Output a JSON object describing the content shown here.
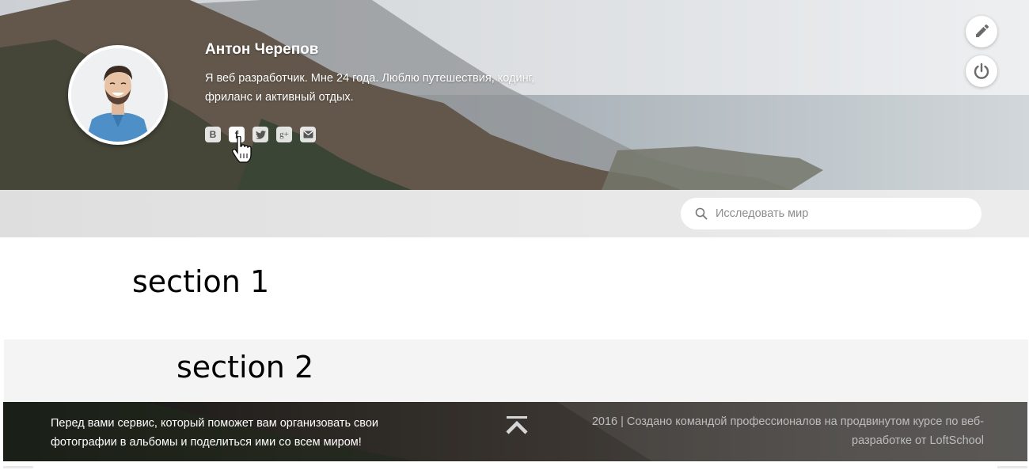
{
  "profile": {
    "name": "Антон Черепов",
    "description": "Я веб разработчик. Мне 24 года. Люблю путешествия, кодинг, фриланс и активный отдых."
  },
  "socials": [
    {
      "icon": "vk-icon",
      "glyph": "B"
    },
    {
      "icon": "facebook-icon",
      "glyph": "f"
    },
    {
      "icon": "twitter-icon"
    },
    {
      "icon": "google-plus-icon",
      "glyph": "g+"
    },
    {
      "icon": "mail-icon"
    }
  ],
  "header_actions": [
    {
      "icon": "pencil-icon"
    },
    {
      "icon": "power-icon"
    }
  ],
  "search": {
    "placeholder": "Исследовать мир",
    "value": ""
  },
  "sections": {
    "section1": "section 1",
    "section2": "section 2"
  },
  "footer": {
    "left_text": "Перед вами сервис, который поможет вам организовать свои фотографии в альбомы и поделиться ими со всем миром!",
    "right_text": "2016 | Создано командой профессионалов на продвинутом курсе по веб-разработке от LoftSchool",
    "to_top_icon": "chevron-up-icon"
  },
  "colors": {
    "accent_white": "#ffffff",
    "footer_text_muted": "#bdbdbd",
    "section2_bg": "#f4f4f4"
  }
}
